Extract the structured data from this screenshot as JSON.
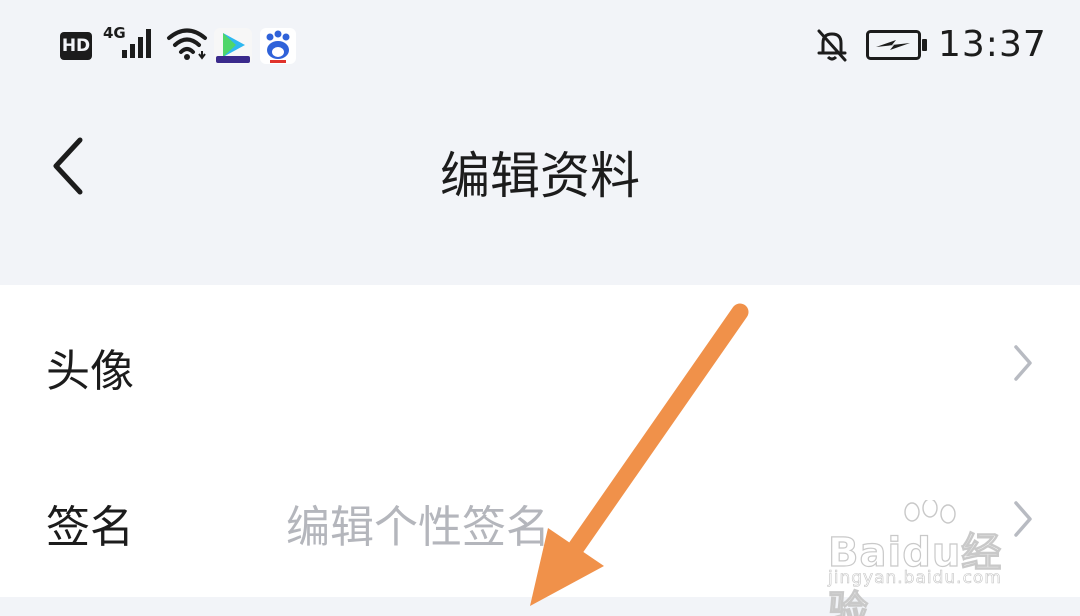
{
  "status_bar": {
    "hd_badge": "HD",
    "network": "4G",
    "time": "13:37",
    "icons": [
      "signal-icon",
      "wifi-icon",
      "video-app-icon",
      "baidu-app-icon",
      "mute-bell-icon",
      "battery-charging-icon"
    ]
  },
  "header": {
    "title": "编辑资料",
    "back_icon": "chevron-left-icon"
  },
  "rows": [
    {
      "label": "头像",
      "placeholder": "",
      "icon": "chevron-right-icon"
    },
    {
      "label": "签名",
      "placeholder": "编辑个性签名",
      "icon": "chevron-right-icon"
    }
  ],
  "annotation": {
    "arrow_color": "#f0914a"
  },
  "watermark": {
    "brand": "Baidu经验",
    "url": "jingyan.baidu.com"
  },
  "colors": {
    "background": "#f2f4f8",
    "panel": "#ffffff",
    "text": "#1c1c1c",
    "placeholder": "#b4b6bc",
    "chevron": "#b8bbc2"
  }
}
